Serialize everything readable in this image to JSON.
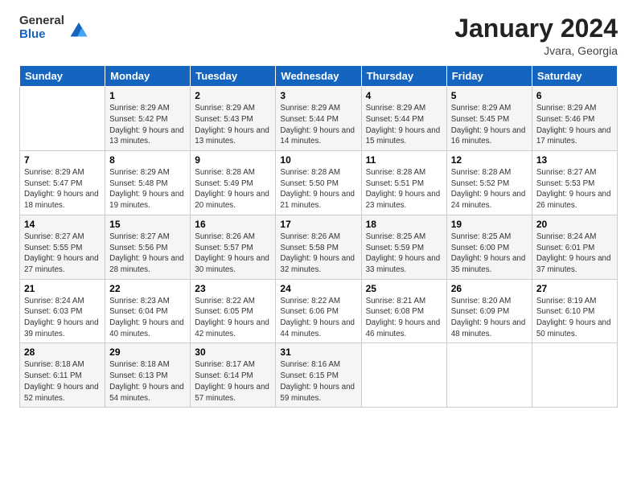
{
  "logo": {
    "general": "General",
    "blue": "Blue"
  },
  "header": {
    "month": "January 2024",
    "location": "Jvara, Georgia"
  },
  "weekdays": [
    "Sunday",
    "Monday",
    "Tuesday",
    "Wednesday",
    "Thursday",
    "Friday",
    "Saturday"
  ],
  "weeks": [
    [
      {
        "day": "",
        "sunrise": "",
        "sunset": "",
        "daylight": ""
      },
      {
        "day": "1",
        "sunrise": "Sunrise: 8:29 AM",
        "sunset": "Sunset: 5:42 PM",
        "daylight": "Daylight: 9 hours and 13 minutes."
      },
      {
        "day": "2",
        "sunrise": "Sunrise: 8:29 AM",
        "sunset": "Sunset: 5:43 PM",
        "daylight": "Daylight: 9 hours and 13 minutes."
      },
      {
        "day": "3",
        "sunrise": "Sunrise: 8:29 AM",
        "sunset": "Sunset: 5:44 PM",
        "daylight": "Daylight: 9 hours and 14 minutes."
      },
      {
        "day": "4",
        "sunrise": "Sunrise: 8:29 AM",
        "sunset": "Sunset: 5:44 PM",
        "daylight": "Daylight: 9 hours and 15 minutes."
      },
      {
        "day": "5",
        "sunrise": "Sunrise: 8:29 AM",
        "sunset": "Sunset: 5:45 PM",
        "daylight": "Daylight: 9 hours and 16 minutes."
      },
      {
        "day": "6",
        "sunrise": "Sunrise: 8:29 AM",
        "sunset": "Sunset: 5:46 PM",
        "daylight": "Daylight: 9 hours and 17 minutes."
      }
    ],
    [
      {
        "day": "7",
        "sunrise": "Sunrise: 8:29 AM",
        "sunset": "Sunset: 5:47 PM",
        "daylight": "Daylight: 9 hours and 18 minutes."
      },
      {
        "day": "8",
        "sunrise": "Sunrise: 8:29 AM",
        "sunset": "Sunset: 5:48 PM",
        "daylight": "Daylight: 9 hours and 19 minutes."
      },
      {
        "day": "9",
        "sunrise": "Sunrise: 8:28 AM",
        "sunset": "Sunset: 5:49 PM",
        "daylight": "Daylight: 9 hours and 20 minutes."
      },
      {
        "day": "10",
        "sunrise": "Sunrise: 8:28 AM",
        "sunset": "Sunset: 5:50 PM",
        "daylight": "Daylight: 9 hours and 21 minutes."
      },
      {
        "day": "11",
        "sunrise": "Sunrise: 8:28 AM",
        "sunset": "Sunset: 5:51 PM",
        "daylight": "Daylight: 9 hours and 23 minutes."
      },
      {
        "day": "12",
        "sunrise": "Sunrise: 8:28 AM",
        "sunset": "Sunset: 5:52 PM",
        "daylight": "Daylight: 9 hours and 24 minutes."
      },
      {
        "day": "13",
        "sunrise": "Sunrise: 8:27 AM",
        "sunset": "Sunset: 5:53 PM",
        "daylight": "Daylight: 9 hours and 26 minutes."
      }
    ],
    [
      {
        "day": "14",
        "sunrise": "Sunrise: 8:27 AM",
        "sunset": "Sunset: 5:55 PM",
        "daylight": "Daylight: 9 hours and 27 minutes."
      },
      {
        "day": "15",
        "sunrise": "Sunrise: 8:27 AM",
        "sunset": "Sunset: 5:56 PM",
        "daylight": "Daylight: 9 hours and 28 minutes."
      },
      {
        "day": "16",
        "sunrise": "Sunrise: 8:26 AM",
        "sunset": "Sunset: 5:57 PM",
        "daylight": "Daylight: 9 hours and 30 minutes."
      },
      {
        "day": "17",
        "sunrise": "Sunrise: 8:26 AM",
        "sunset": "Sunset: 5:58 PM",
        "daylight": "Daylight: 9 hours and 32 minutes."
      },
      {
        "day": "18",
        "sunrise": "Sunrise: 8:25 AM",
        "sunset": "Sunset: 5:59 PM",
        "daylight": "Daylight: 9 hours and 33 minutes."
      },
      {
        "day": "19",
        "sunrise": "Sunrise: 8:25 AM",
        "sunset": "Sunset: 6:00 PM",
        "daylight": "Daylight: 9 hours and 35 minutes."
      },
      {
        "day": "20",
        "sunrise": "Sunrise: 8:24 AM",
        "sunset": "Sunset: 6:01 PM",
        "daylight": "Daylight: 9 hours and 37 minutes."
      }
    ],
    [
      {
        "day": "21",
        "sunrise": "Sunrise: 8:24 AM",
        "sunset": "Sunset: 6:03 PM",
        "daylight": "Daylight: 9 hours and 39 minutes."
      },
      {
        "day": "22",
        "sunrise": "Sunrise: 8:23 AM",
        "sunset": "Sunset: 6:04 PM",
        "daylight": "Daylight: 9 hours and 40 minutes."
      },
      {
        "day": "23",
        "sunrise": "Sunrise: 8:22 AM",
        "sunset": "Sunset: 6:05 PM",
        "daylight": "Daylight: 9 hours and 42 minutes."
      },
      {
        "day": "24",
        "sunrise": "Sunrise: 8:22 AM",
        "sunset": "Sunset: 6:06 PM",
        "daylight": "Daylight: 9 hours and 44 minutes."
      },
      {
        "day": "25",
        "sunrise": "Sunrise: 8:21 AM",
        "sunset": "Sunset: 6:08 PM",
        "daylight": "Daylight: 9 hours and 46 minutes."
      },
      {
        "day": "26",
        "sunrise": "Sunrise: 8:20 AM",
        "sunset": "Sunset: 6:09 PM",
        "daylight": "Daylight: 9 hours and 48 minutes."
      },
      {
        "day": "27",
        "sunrise": "Sunrise: 8:19 AM",
        "sunset": "Sunset: 6:10 PM",
        "daylight": "Daylight: 9 hours and 50 minutes."
      }
    ],
    [
      {
        "day": "28",
        "sunrise": "Sunrise: 8:18 AM",
        "sunset": "Sunset: 6:11 PM",
        "daylight": "Daylight: 9 hours and 52 minutes."
      },
      {
        "day": "29",
        "sunrise": "Sunrise: 8:18 AM",
        "sunset": "Sunset: 6:13 PM",
        "daylight": "Daylight: 9 hours and 54 minutes."
      },
      {
        "day": "30",
        "sunrise": "Sunrise: 8:17 AM",
        "sunset": "Sunset: 6:14 PM",
        "daylight": "Daylight: 9 hours and 57 minutes."
      },
      {
        "day": "31",
        "sunrise": "Sunrise: 8:16 AM",
        "sunset": "Sunset: 6:15 PM",
        "daylight": "Daylight: 9 hours and 59 minutes."
      },
      {
        "day": "",
        "sunrise": "",
        "sunset": "",
        "daylight": ""
      },
      {
        "day": "",
        "sunrise": "",
        "sunset": "",
        "daylight": ""
      },
      {
        "day": "",
        "sunrise": "",
        "sunset": "",
        "daylight": ""
      }
    ]
  ]
}
